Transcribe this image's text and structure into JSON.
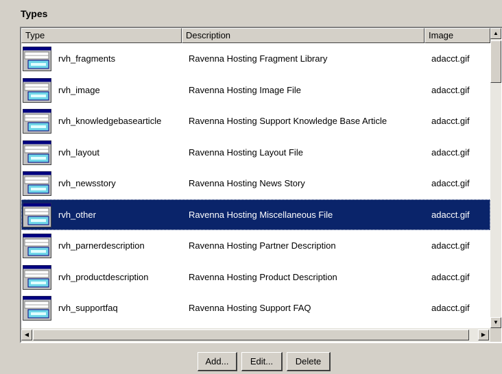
{
  "section_title": "Types",
  "columns": {
    "type": "Type",
    "description": "Description",
    "image": "Image"
  },
  "rows": [
    {
      "type": "rvh_fragments",
      "description": "Ravenna Hosting Fragment Library",
      "image": "adacct.gif",
      "selected": false
    },
    {
      "type": "rvh_image",
      "description": "Ravenna Hosting Image File",
      "image": "adacct.gif",
      "selected": false
    },
    {
      "type": "rvh_knowledgebasearticle",
      "description": "Ravenna Hosting Support Knowledge Base Article",
      "image": "adacct.gif",
      "selected": false
    },
    {
      "type": "rvh_layout",
      "description": "Ravenna Hosting Layout File",
      "image": "adacct.gif",
      "selected": false
    },
    {
      "type": "rvh_newsstory",
      "description": "Ravenna Hosting News Story",
      "image": "adacct.gif",
      "selected": false
    },
    {
      "type": "rvh_other",
      "description": "Ravenna Hosting Miscellaneous File",
      "image": "adacct.gif",
      "selected": true
    },
    {
      "type": "rvh_parnerdescription",
      "description": "Ravenna Hosting Partner Description",
      "image": "adacct.gif",
      "selected": false
    },
    {
      "type": "rvh_productdescription",
      "description": "Ravenna Hosting Product Description",
      "image": "adacct.gif",
      "selected": false
    },
    {
      "type": "rvh_supportfaq",
      "description": "Ravenna Hosting Support FAQ",
      "image": "adacct.gif",
      "selected": false
    }
  ],
  "buttons": {
    "add": "Add...",
    "edit": "Edit...",
    "delete": "Delete"
  },
  "icons": {
    "row_icon": "type-icon",
    "scroll_up": "arrow-up-icon",
    "scroll_down": "arrow-down-icon",
    "scroll_left": "arrow-left-icon",
    "scroll_right": "arrow-right-icon"
  },
  "colors": {
    "selection": "#0a246a",
    "window": "#d4d0c8"
  }
}
